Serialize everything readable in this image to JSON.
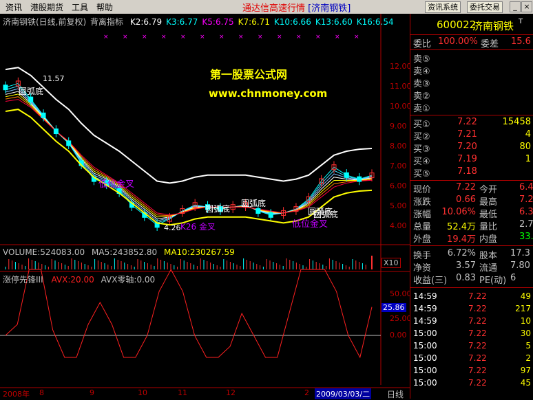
{
  "menubar": {
    "items": [
      "资讯",
      "港股期货",
      "工具",
      "帮助"
    ],
    "app_title": "通达信高速行情",
    "stock_tag": "[济南钢铁]",
    "btn_info": "资讯系统",
    "btn_trade": "委托交易"
  },
  "chart": {
    "title": "济南钢铁(日线,前复权)",
    "indicator": "背离指标",
    "ma_labels": [
      {
        "text": "K2:6.79",
        "color": "#ffffff"
      },
      {
        "text": "K3:6.77",
        "color": "#00ffff"
      },
      {
        "text": "K5:6.75",
        "color": "#ff00ff"
      },
      {
        "text": "K7:6.71",
        "color": "#ffff00"
      },
      {
        "text": "K10:6.66",
        "color": "#00ffff"
      },
      {
        "text": "K13:6.60",
        "color": "#00ffff"
      },
      {
        "text": "K16:6.54",
        "color": "#00ffff"
      }
    ],
    "watermark_1": "第一股票公式网",
    "watermark_2": "www.chnmoney.com",
    "high_label": "11.57",
    "low_label": "4.26",
    "price_ticks": [
      "12.00",
      "11.00",
      "10.00",
      "9.00",
      "8.00",
      "7.00",
      "6.00",
      "5.00",
      "4.00"
    ],
    "annotations": [
      "圆弧底",
      "低位金叉",
      "圆弧底",
      "圆弧底",
      "K26 金叉",
      "圆弧底",
      "低位金叉",
      "圆弧底"
    ],
    "volume_label": "VOLUME:524083.00",
    "ma5_label": "MA5:243852.80",
    "ma10_label": "MA10:230267.59",
    "x10_label": "X10",
    "ind_name": "涨停先锋III",
    "avx_label": "AVX:20.00",
    "avx_zero": "AVX零轴:0.00",
    "ind_ticks": [
      "50.00",
      "25.00",
      "0.00"
    ],
    "ind_current": "25.86",
    "x_labels": [
      "2008年",
      "8",
      "9",
      "10",
      "11",
      "12",
      "2"
    ],
    "date_box": "2009/03/03/二",
    "period": "日线"
  },
  "chart_data": [
    {
      "type": "line",
      "title": "济南钢铁(日线,前复权) 背离指标",
      "ylim": [
        4,
        12
      ],
      "ylabel": "",
      "series": [
        {
          "name": "K2",
          "values": [
            11.2,
            11.4,
            10.6,
            9.8,
            9.0,
            8.4,
            7.4,
            6.6,
            6.4,
            6.0,
            5.3,
            4.8,
            4.3,
            4.6,
            5.0,
            5.3,
            5.2,
            5.1,
            5.2,
            5.3,
            5.0,
            4.8,
            4.9,
            5.1,
            5.6,
            6.5,
            7.2,
            6.8,
            6.6,
            6.79
          ]
        },
        {
          "name": "K16",
          "values": [
            10.5,
            10.6,
            10.2,
            9.6,
            9.0,
            8.5,
            7.8,
            7.2,
            6.8,
            6.4,
            5.9,
            5.4,
            4.9,
            4.8,
            4.9,
            5.1,
            5.2,
            5.2,
            5.2,
            5.2,
            5.1,
            5.0,
            4.9,
            5.0,
            5.2,
            5.7,
            6.2,
            6.4,
            6.5,
            6.54
          ]
        }
      ]
    },
    {
      "type": "line",
      "title": "涨停先锋III",
      "ylim": [
        -25,
        65
      ],
      "series": [
        {
          "name": "AVX",
          "values": [
            0,
            10,
            60,
            60,
            5,
            -20,
            -20,
            10,
            30,
            10,
            -20,
            -20,
            0,
            40,
            60,
            40,
            0,
            -20,
            -20,
            -10,
            20,
            0,
            -20,
            -20,
            20,
            60,
            60,
            60,
            40,
            0,
            -20,
            25.86
          ]
        }
      ]
    }
  ],
  "quote": {
    "code": "600022",
    "name": "济南钢铁",
    "weibi_label": "委比",
    "weibi_value": "100.00%",
    "weicha_label": "委差",
    "weicha_value": "15.6",
    "sell_labels": [
      "卖⑤",
      "卖④",
      "卖③",
      "卖②",
      "卖①"
    ],
    "buy": [
      {
        "label": "买①",
        "price": "7.22",
        "vol": "15458"
      },
      {
        "label": "买②",
        "price": "7.21",
        "vol": "4"
      },
      {
        "label": "买③",
        "price": "7.20",
        "vol": "80"
      },
      {
        "label": "买④",
        "price": "7.19",
        "vol": "1"
      },
      {
        "label": "买⑤",
        "price": "7.18",
        "vol": ""
      }
    ],
    "stats": [
      {
        "l1": "现价",
        "v1": "7.22",
        "l2": "今开",
        "v2": "6.4"
      },
      {
        "l1": "涨跌",
        "v1": "0.66",
        "l2": "最高",
        "v2": "7.2"
      },
      {
        "l1": "涨幅",
        "v1": "10.06%",
        "l2": "最低",
        "v2": "6.3"
      },
      {
        "l1": "总量",
        "v1": "52.4万",
        "l2": "量比",
        "v2": "2.7"
      },
      {
        "l1": "外盘",
        "v1": "19.4万",
        "l2": "内盘",
        "v2": "33.0"
      }
    ],
    "fund": [
      {
        "l1": "换手",
        "v1": "6.72%",
        "l2": "股本",
        "v2": "17.3"
      },
      {
        "l1": "净资",
        "v1": "3.57",
        "l2": "流通",
        "v2": "7.80"
      },
      {
        "l1": "收益(三)",
        "v1": "0.83",
        "l2": "PE(动)",
        "v2": "6"
      }
    ],
    "trades": [
      {
        "time": "14:59",
        "price": "7.22",
        "vol": "49"
      },
      {
        "time": "14:59",
        "price": "7.22",
        "vol": "217"
      },
      {
        "time": "14:59",
        "price": "7.22",
        "vol": "10"
      },
      {
        "time": "15:00",
        "price": "7.22",
        "vol": "30"
      },
      {
        "time": "15:00",
        "price": "7.22",
        "vol": "5"
      },
      {
        "time": "15:00",
        "price": "7.22",
        "vol": "2"
      },
      {
        "time": "15:00",
        "price": "7.22",
        "vol": "97"
      },
      {
        "time": "15:00",
        "price": "7.22",
        "vol": "45"
      }
    ]
  }
}
